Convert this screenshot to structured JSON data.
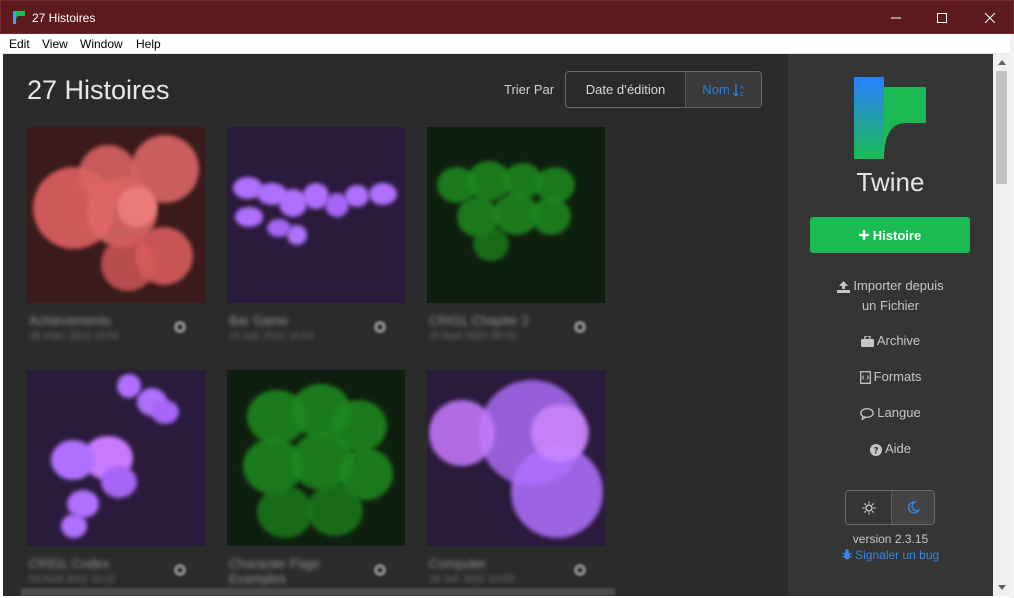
{
  "window": {
    "title": "27 Histoires",
    "controls": {
      "minimize": "minimize-icon",
      "maximize": "maximize-icon",
      "close": "close-icon"
    }
  },
  "menu": [
    "Edit",
    "View",
    "Window",
    "Help"
  ],
  "library": {
    "heading": "27 Histoires",
    "sort_label": "Trier Par",
    "sort_options": [
      "Date d’édition",
      "Nom"
    ],
    "sort_active": "Nom",
    "stories": [
      {
        "name": "Achievements",
        "date": "28 Sept. 2022 19:56",
        "palette": "#e06060",
        "bg": "#3a1a1a"
      },
      {
        "name": "Bar Game",
        "date": "15 Juil. 2022 16:03",
        "palette": "#b070ff",
        "bg": "#2a1a3c"
      },
      {
        "name": "CRIGL Chapter 2",
        "date": "20 Août 2022 09:33",
        "palette": "#1e8a1e",
        "bg": "#0f1f0f"
      },
      {
        "name": "CRIGL Codex",
        "date": "03 Août 2022 10:12",
        "palette": "#c070ff",
        "bg": "#2a1a3c"
      },
      {
        "name": "Character Page Examples",
        "date": "",
        "palette": "#1e8a1e",
        "bg": "#0f1f0f"
      },
      {
        "name": "Computer",
        "date": "18 Juil. 2022 14:09",
        "palette": "#c070f0",
        "bg": "#2a1a3c"
      }
    ]
  },
  "sidebar": {
    "brand": "Twine",
    "new_story": "Histoire",
    "import": [
      "Importer depuis",
      "un Fichier"
    ],
    "archive": "Archive",
    "formats": "Formats",
    "language": "Langue",
    "help": "Aide",
    "version": "version 2.3.15",
    "report_bug": "Signaler un bug"
  },
  "colors": {
    "titlebar": "#5e1b1e",
    "library_bg": "#2b2b2b",
    "sidebar_bg": "#353535",
    "accent_green": "#19bb52",
    "link_blue": "#3b86e6"
  }
}
